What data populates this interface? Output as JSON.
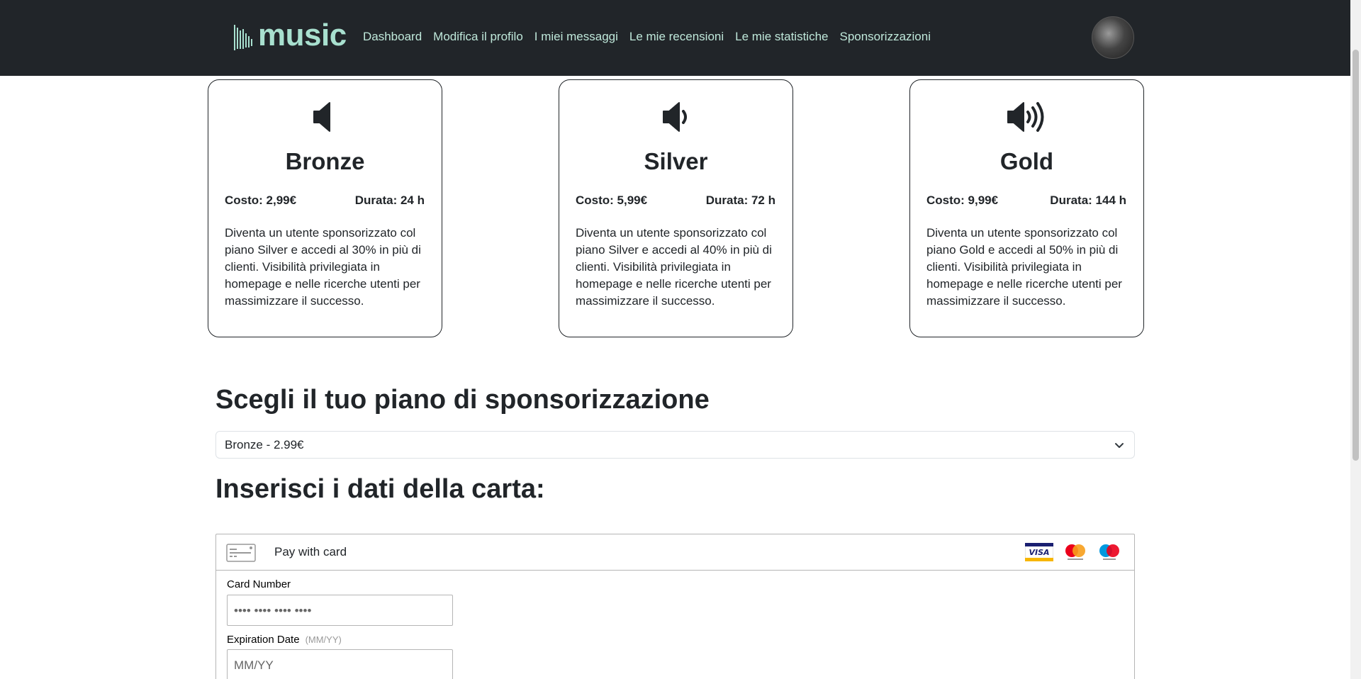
{
  "brand": {
    "name": "music",
    "color": "#a8e0cf"
  },
  "nav": {
    "links": [
      {
        "label": "Dashboard"
      },
      {
        "label": "Modifica il profilo"
      },
      {
        "label": "I miei messaggi"
      },
      {
        "label": "Le mie recensioni"
      },
      {
        "label": "Le mie statistiche"
      },
      {
        "label": "Sponsorizzazioni"
      }
    ],
    "background": "#212529"
  },
  "plans": [
    {
      "title": "Bronze",
      "cost": "Costo: 2,99€",
      "duration": "Durata: 24 h",
      "icon": "volume-off-icon",
      "description": "Diventa un utente sponsorizzato col piano Silver e accedi al 30% in più di clienti. Visibilità privilegiata in homepage e nelle ricerche utenti per massimizzare il successo."
    },
    {
      "title": "Silver",
      "cost": "Costo: 5,99€",
      "duration": "Durata: 72 h",
      "icon": "volume-low-icon",
      "description": "Diventa un utente sponsorizzato col piano Silver e accedi al 40% in più di clienti. Visibilità privilegiata in homepage e nelle ricerche utenti per massimizzare il successo."
    },
    {
      "title": "Gold",
      "cost": "Costo: 9,99€",
      "duration": "Durata: 144 h",
      "icon": "volume-high-icon",
      "description": "Diventa un utente sponsorizzato col piano Gold e accedi al 50% in più di clienti. Visibilità privilegiata in homepage e nelle ricerche utenti per massimizzare il successo."
    }
  ],
  "plan_section": {
    "heading": "Scegli il tuo piano di sponsorizzazione",
    "selected": "Bronze - 2.99€"
  },
  "card_section": {
    "heading": "Inserisci i dati della carta:"
  },
  "payment": {
    "title": "Pay with card",
    "brands": [
      "visa-icon",
      "mastercard-icon",
      "maestro-icon"
    ],
    "card_number_label": "Card Number",
    "card_number_placeholder": "•••• •••• •••• ••••",
    "expiration_label": "Expiration Date",
    "expiration_hint": "(MM/YY)",
    "expiration_placeholder": "MM/YY"
  }
}
